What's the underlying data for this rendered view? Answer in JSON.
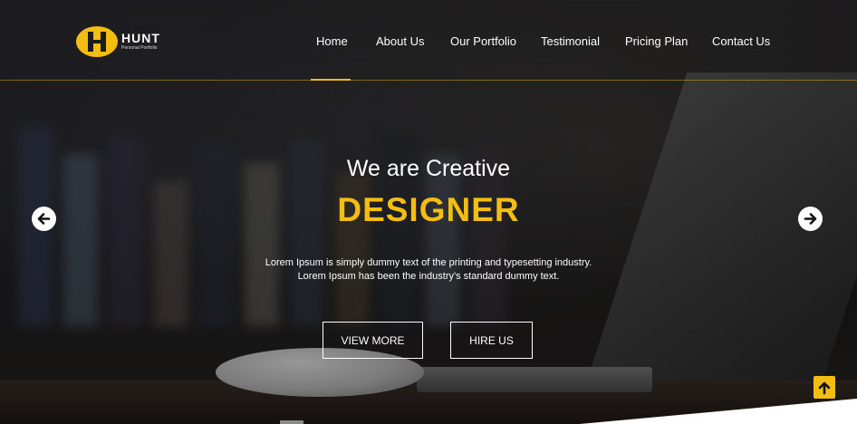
{
  "logo": {
    "title": "HUNT",
    "subtitle": "Personal Portfolio"
  },
  "nav": {
    "items": [
      {
        "label": "Home",
        "active": true
      },
      {
        "label": "About Us"
      },
      {
        "label": "Our Portfolio"
      },
      {
        "label": "Testimonial"
      },
      {
        "label": "Pricing Plan"
      },
      {
        "label": "Contact Us"
      }
    ]
  },
  "hero": {
    "headline": "We are Creative",
    "headline_strong": "DESIGNER",
    "description": "Lorem Ipsum is simply dummy text of the printing and typesetting industry. Lorem Ipsum has been the industry's standard dummy text.",
    "buttons": {
      "view_more": "VIEW MORE",
      "hire_us": "HIRE US"
    }
  },
  "icons": {
    "prev": "arrow-left-icon",
    "next": "arrow-right-icon",
    "to_top": "arrow-up-icon"
  },
  "colors": {
    "accent": "#f3bd12",
    "text": "#ffffff"
  }
}
